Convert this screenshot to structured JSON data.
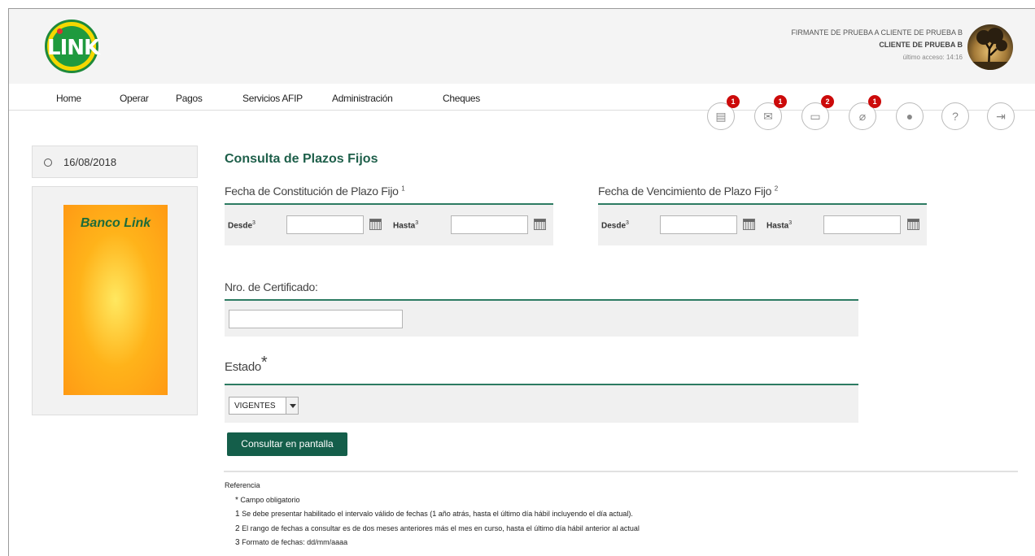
{
  "header": {
    "logo_text": "LINK",
    "user_line1": "FIRMANTE DE PRUEBA A CLIENTE DE PRUEBA B",
    "user_line2": "CLIENTE DE PRUEBA B",
    "last_access": "último acceso: 14:16"
  },
  "nav": {
    "items": [
      "Home",
      "Operar",
      "Pagos",
      "Servicios AFIP",
      "Administración",
      "Cheques"
    ]
  },
  "toolbar": {
    "icons": [
      {
        "name": "document-icon",
        "glyph": "▤",
        "badge": "1"
      },
      {
        "name": "mail-icon",
        "glyph": "✉",
        "badge": "1"
      },
      {
        "name": "folder-icon",
        "glyph": "▭",
        "badge": "2"
      },
      {
        "name": "attachment-icon",
        "glyph": "⌀",
        "badge": "1"
      },
      {
        "name": "user-icon",
        "glyph": "●",
        "badge": ""
      },
      {
        "name": "help-icon",
        "glyph": "?",
        "badge": ""
      },
      {
        "name": "logout-icon",
        "glyph": "⇥",
        "badge": ""
      }
    ]
  },
  "sidebar": {
    "date": "16/08/2018",
    "banner_text": "Banco Link"
  },
  "main": {
    "title": "Consulta de Plazos Fijos",
    "constitucion": {
      "title": "Fecha de Constitución de Plazo Fijo",
      "sup": "1",
      "desde": "Desde",
      "hasta": "Hasta",
      "sup3": "3"
    },
    "vencimiento": {
      "title": "Fecha de Vencimiento de Plazo Fijo",
      "sup": "2",
      "desde": "Desde",
      "hasta": "Hasta",
      "sup3": "3"
    },
    "certificado": {
      "title": "Nro. de Certificado:"
    },
    "estado": {
      "title": "Estado",
      "required_mark": "*",
      "selected": "VIGENTES"
    },
    "submit_label": "Consultar en pantalla"
  },
  "references": {
    "title": "Referencia",
    "items": [
      {
        "mark": "*",
        "text": "Campo obligatorio"
      },
      {
        "mark": "1",
        "text": "Se debe presentar habilitado el intervalo válido de fechas (1 año atrás, hasta el último día hábil incluyendo el día actual)."
      },
      {
        "mark": "2",
        "text": "El rango de fechas a consultar es de dos meses anteriores más el mes en curso, hasta el último día hábil anterior al actual"
      },
      {
        "mark": "3",
        "text": "Formato de fechas: dd/mm/aaaa"
      }
    ]
  }
}
